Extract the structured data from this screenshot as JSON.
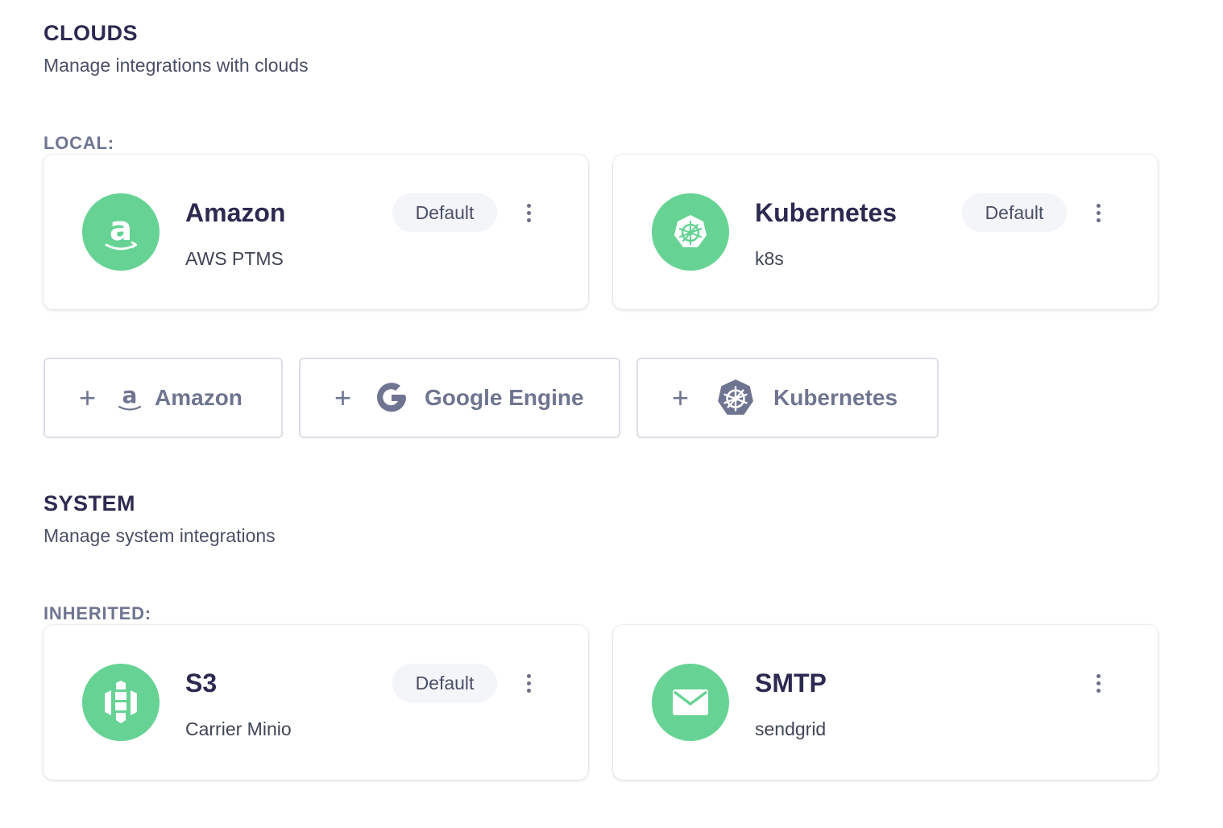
{
  "clouds": {
    "title": "CLOUDS",
    "subtitle": "Manage integrations with clouds",
    "local_label": "LOCAL:",
    "cards": [
      {
        "name": "Amazon",
        "description": "AWS PTMS",
        "badge": "Default",
        "icon": "amazon-icon"
      },
      {
        "name": "Kubernetes",
        "description": "k8s",
        "badge": "Default",
        "icon": "kubernetes-icon"
      }
    ],
    "add_buttons": [
      {
        "label": "Amazon",
        "icon": "amazon-icon"
      },
      {
        "label": "Google Engine",
        "icon": "google-icon"
      },
      {
        "label": "Kubernetes",
        "icon": "kubernetes-icon"
      }
    ]
  },
  "system": {
    "title": "SYSTEM",
    "subtitle": "Manage system integrations",
    "inherited_label": "INHERITED:",
    "cards": [
      {
        "name": "S3",
        "description": "Carrier Minio",
        "badge": "Default",
        "icon": "minio-icon"
      },
      {
        "name": "SMTP",
        "description": "sendgrid",
        "icon": "envelope-icon"
      }
    ]
  },
  "colors": {
    "accent_green": "#66d394",
    "heading": "#2c2a50",
    "muted": "#6f7590",
    "badge_bg": "#f3f5f9"
  }
}
